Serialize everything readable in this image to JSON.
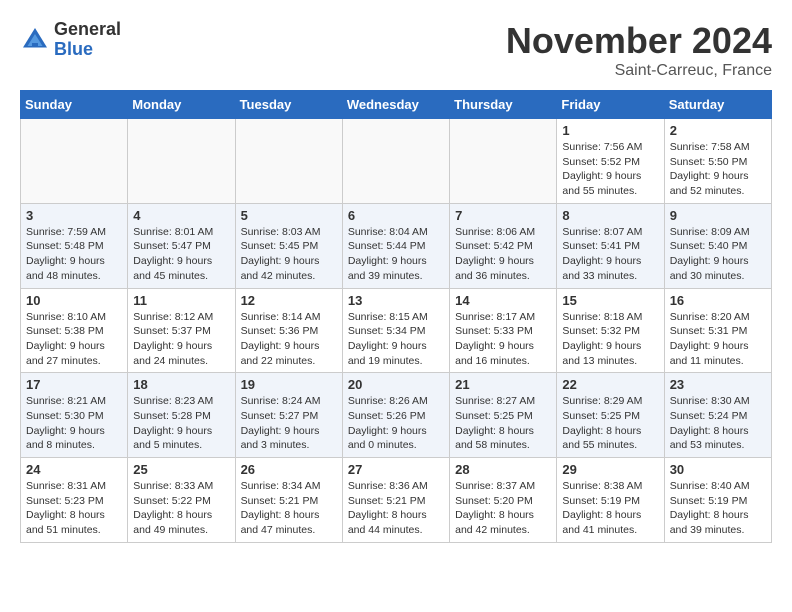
{
  "logo": {
    "general": "General",
    "blue": "Blue"
  },
  "title": "November 2024",
  "location": "Saint-Carreuc, France",
  "days_of_week": [
    "Sunday",
    "Monday",
    "Tuesday",
    "Wednesday",
    "Thursday",
    "Friday",
    "Saturday"
  ],
  "weeks": [
    [
      {
        "day": "",
        "info": ""
      },
      {
        "day": "",
        "info": ""
      },
      {
        "day": "",
        "info": ""
      },
      {
        "day": "",
        "info": ""
      },
      {
        "day": "",
        "info": ""
      },
      {
        "day": "1",
        "info": "Sunrise: 7:56 AM\nSunset: 5:52 PM\nDaylight: 9 hours and 55 minutes."
      },
      {
        "day": "2",
        "info": "Sunrise: 7:58 AM\nSunset: 5:50 PM\nDaylight: 9 hours and 52 minutes."
      }
    ],
    [
      {
        "day": "3",
        "info": "Sunrise: 7:59 AM\nSunset: 5:48 PM\nDaylight: 9 hours and 48 minutes."
      },
      {
        "day": "4",
        "info": "Sunrise: 8:01 AM\nSunset: 5:47 PM\nDaylight: 9 hours and 45 minutes."
      },
      {
        "day": "5",
        "info": "Sunrise: 8:03 AM\nSunset: 5:45 PM\nDaylight: 9 hours and 42 minutes."
      },
      {
        "day": "6",
        "info": "Sunrise: 8:04 AM\nSunset: 5:44 PM\nDaylight: 9 hours and 39 minutes."
      },
      {
        "day": "7",
        "info": "Sunrise: 8:06 AM\nSunset: 5:42 PM\nDaylight: 9 hours and 36 minutes."
      },
      {
        "day": "8",
        "info": "Sunrise: 8:07 AM\nSunset: 5:41 PM\nDaylight: 9 hours and 33 minutes."
      },
      {
        "day": "9",
        "info": "Sunrise: 8:09 AM\nSunset: 5:40 PM\nDaylight: 9 hours and 30 minutes."
      }
    ],
    [
      {
        "day": "10",
        "info": "Sunrise: 8:10 AM\nSunset: 5:38 PM\nDaylight: 9 hours and 27 minutes."
      },
      {
        "day": "11",
        "info": "Sunrise: 8:12 AM\nSunset: 5:37 PM\nDaylight: 9 hours and 24 minutes."
      },
      {
        "day": "12",
        "info": "Sunrise: 8:14 AM\nSunset: 5:36 PM\nDaylight: 9 hours and 22 minutes."
      },
      {
        "day": "13",
        "info": "Sunrise: 8:15 AM\nSunset: 5:34 PM\nDaylight: 9 hours and 19 minutes."
      },
      {
        "day": "14",
        "info": "Sunrise: 8:17 AM\nSunset: 5:33 PM\nDaylight: 9 hours and 16 minutes."
      },
      {
        "day": "15",
        "info": "Sunrise: 8:18 AM\nSunset: 5:32 PM\nDaylight: 9 hours and 13 minutes."
      },
      {
        "day": "16",
        "info": "Sunrise: 8:20 AM\nSunset: 5:31 PM\nDaylight: 9 hours and 11 minutes."
      }
    ],
    [
      {
        "day": "17",
        "info": "Sunrise: 8:21 AM\nSunset: 5:30 PM\nDaylight: 9 hours and 8 minutes."
      },
      {
        "day": "18",
        "info": "Sunrise: 8:23 AM\nSunset: 5:28 PM\nDaylight: 9 hours and 5 minutes."
      },
      {
        "day": "19",
        "info": "Sunrise: 8:24 AM\nSunset: 5:27 PM\nDaylight: 9 hours and 3 minutes."
      },
      {
        "day": "20",
        "info": "Sunrise: 8:26 AM\nSunset: 5:26 PM\nDaylight: 9 hours and 0 minutes."
      },
      {
        "day": "21",
        "info": "Sunrise: 8:27 AM\nSunset: 5:25 PM\nDaylight: 8 hours and 58 minutes."
      },
      {
        "day": "22",
        "info": "Sunrise: 8:29 AM\nSunset: 5:25 PM\nDaylight: 8 hours and 55 minutes."
      },
      {
        "day": "23",
        "info": "Sunrise: 8:30 AM\nSunset: 5:24 PM\nDaylight: 8 hours and 53 minutes."
      }
    ],
    [
      {
        "day": "24",
        "info": "Sunrise: 8:31 AM\nSunset: 5:23 PM\nDaylight: 8 hours and 51 minutes."
      },
      {
        "day": "25",
        "info": "Sunrise: 8:33 AM\nSunset: 5:22 PM\nDaylight: 8 hours and 49 minutes."
      },
      {
        "day": "26",
        "info": "Sunrise: 8:34 AM\nSunset: 5:21 PM\nDaylight: 8 hours and 47 minutes."
      },
      {
        "day": "27",
        "info": "Sunrise: 8:36 AM\nSunset: 5:21 PM\nDaylight: 8 hours and 44 minutes."
      },
      {
        "day": "28",
        "info": "Sunrise: 8:37 AM\nSunset: 5:20 PM\nDaylight: 8 hours and 42 minutes."
      },
      {
        "day": "29",
        "info": "Sunrise: 8:38 AM\nSunset: 5:19 PM\nDaylight: 8 hours and 41 minutes."
      },
      {
        "day": "30",
        "info": "Sunrise: 8:40 AM\nSunset: 5:19 PM\nDaylight: 8 hours and 39 minutes."
      }
    ]
  ]
}
